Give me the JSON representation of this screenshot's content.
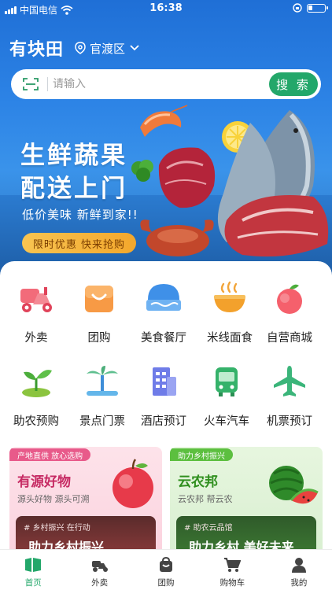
{
  "status_bar": {
    "carrier": "中国电信",
    "time": "16:38",
    "battery_level": 0.25
  },
  "header": {
    "app_title": "有块田",
    "location": "官渡区"
  },
  "search": {
    "placeholder": "请输入",
    "button_label": "搜 索"
  },
  "banner": {
    "headline_line1": "生鲜蔬果",
    "headline_line2": "配送上门",
    "subtitle": "低价美味 新鲜到家!!",
    "cta_label": "限时优惠  快来抢购"
  },
  "categories": [
    {
      "label": "外卖",
      "icon": "scooter-icon"
    },
    {
      "label": "团购",
      "icon": "shopping-bag-icon"
    },
    {
      "label": "美食餐厅",
      "icon": "food-dome-icon"
    },
    {
      "label": "米线面食",
      "icon": "noodle-bowl-icon"
    },
    {
      "label": "自营商城",
      "icon": "apple-icon"
    },
    {
      "label": "助农预购",
      "icon": "sprout-icon"
    },
    {
      "label": "景点门票",
      "icon": "palm-tree-icon"
    },
    {
      "label": "酒店预订",
      "icon": "building-icon"
    },
    {
      "label": "火车汽车",
      "icon": "bus-icon"
    },
    {
      "label": "机票预订",
      "icon": "airplane-icon"
    }
  ],
  "promo_cards": [
    {
      "tag": "产地直供 放心选购",
      "title": "有源好物",
      "subtitle": "源头好物 源头可溯",
      "inner_tag": "# 乡村振兴 在行动",
      "inner_title": "助力乡村振兴"
    },
    {
      "tag": "助力乡村振兴",
      "title": "云农邦",
      "subtitle": "云农邦 帮云农",
      "inner_tag": "# 助农云品馆",
      "inner_title": "助力乡村 美好未来"
    }
  ],
  "tabbar": [
    {
      "label": "首页",
      "icon": "home-icon",
      "active": true
    },
    {
      "label": "外卖",
      "icon": "scooter-icon",
      "active": false
    },
    {
      "label": "团购",
      "icon": "bag-icon",
      "active": false
    },
    {
      "label": "购物车",
      "icon": "cart-icon",
      "active": false
    },
    {
      "label": "我的",
      "icon": "user-icon",
      "active": false
    }
  ],
  "colors": {
    "accent_green": "#23a76a",
    "hero_blue": "#2d84e6",
    "cta_orange": "#f3a72c"
  }
}
